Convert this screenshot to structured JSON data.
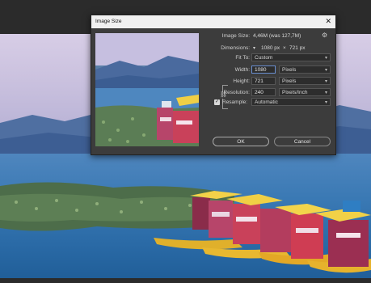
{
  "dialog": {
    "title": "Image Size",
    "close_label": "✕",
    "image_size_label": "Image Size:",
    "image_size_value": "4,46M (was 127,7M)",
    "dimensions_label": "Dimensions:",
    "dimensions_w": "1080 px",
    "dimensions_x": "×",
    "dimensions_h": "721 px",
    "fit_to_label": "Fit To:",
    "fit_to_value": "Custom",
    "width_label": "Width:",
    "width_value": "1080",
    "width_unit": "Pixels",
    "height_label": "Height:",
    "height_value": "721",
    "height_unit": "Pixels",
    "resolution_label": "Resolution:",
    "resolution_value": "240",
    "resolution_unit": "Pixels/Inch",
    "resample_label": "Resample:",
    "resample_checked": true,
    "resample_value": "Automatic",
    "ok_label": "OK",
    "cancel_label": "Cancel"
  },
  "icons": {
    "settings": "gear-icon",
    "dimensions": "dimensions-dropdown-icon",
    "link": "link-icon",
    "chevron": "chevron-down-icon"
  }
}
